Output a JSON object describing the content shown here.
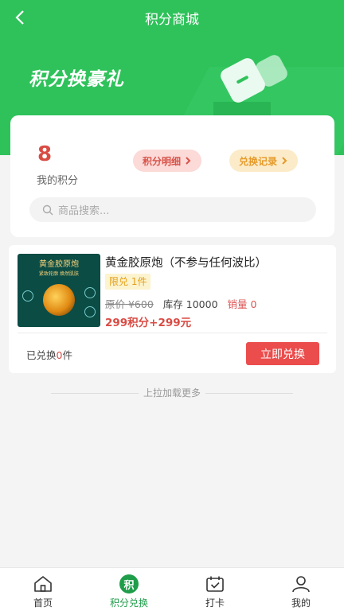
{
  "nav": {
    "title": "积分商城"
  },
  "banner": {
    "text": "积分换豪礼"
  },
  "points": {
    "value": "8",
    "label": "我的积分"
  },
  "actions": {
    "detail_label": "积分明细",
    "record_label": "兑换记录"
  },
  "search": {
    "placeholder": "商品搜索..."
  },
  "product": {
    "image_title": "黄金胶原炮",
    "image_sub": "紧致轮廓 焕然肌肤",
    "name": "黄金胶原炮（不参与任何波比）",
    "limit_tag": "限兑 1件",
    "original_price": "原价 ¥600",
    "stock": "库存 10000",
    "sales": "销量 0",
    "price": "299积分+299元",
    "exchanged_prefix": "已兑换",
    "exchanged_count": "0",
    "exchanged_suffix": "件",
    "buy_label": "立即兑换"
  },
  "loadmore": {
    "text": "上拉加载更多"
  },
  "tabbar": {
    "home": "首页",
    "points_exchange": "积分兑换",
    "points_badge": "积",
    "checkin": "打卡",
    "mine": "我的"
  },
  "colors": {
    "brand": "#2fc25b",
    "accent_red": "#eb4d4d",
    "active_tab": "#1f9d4a"
  }
}
